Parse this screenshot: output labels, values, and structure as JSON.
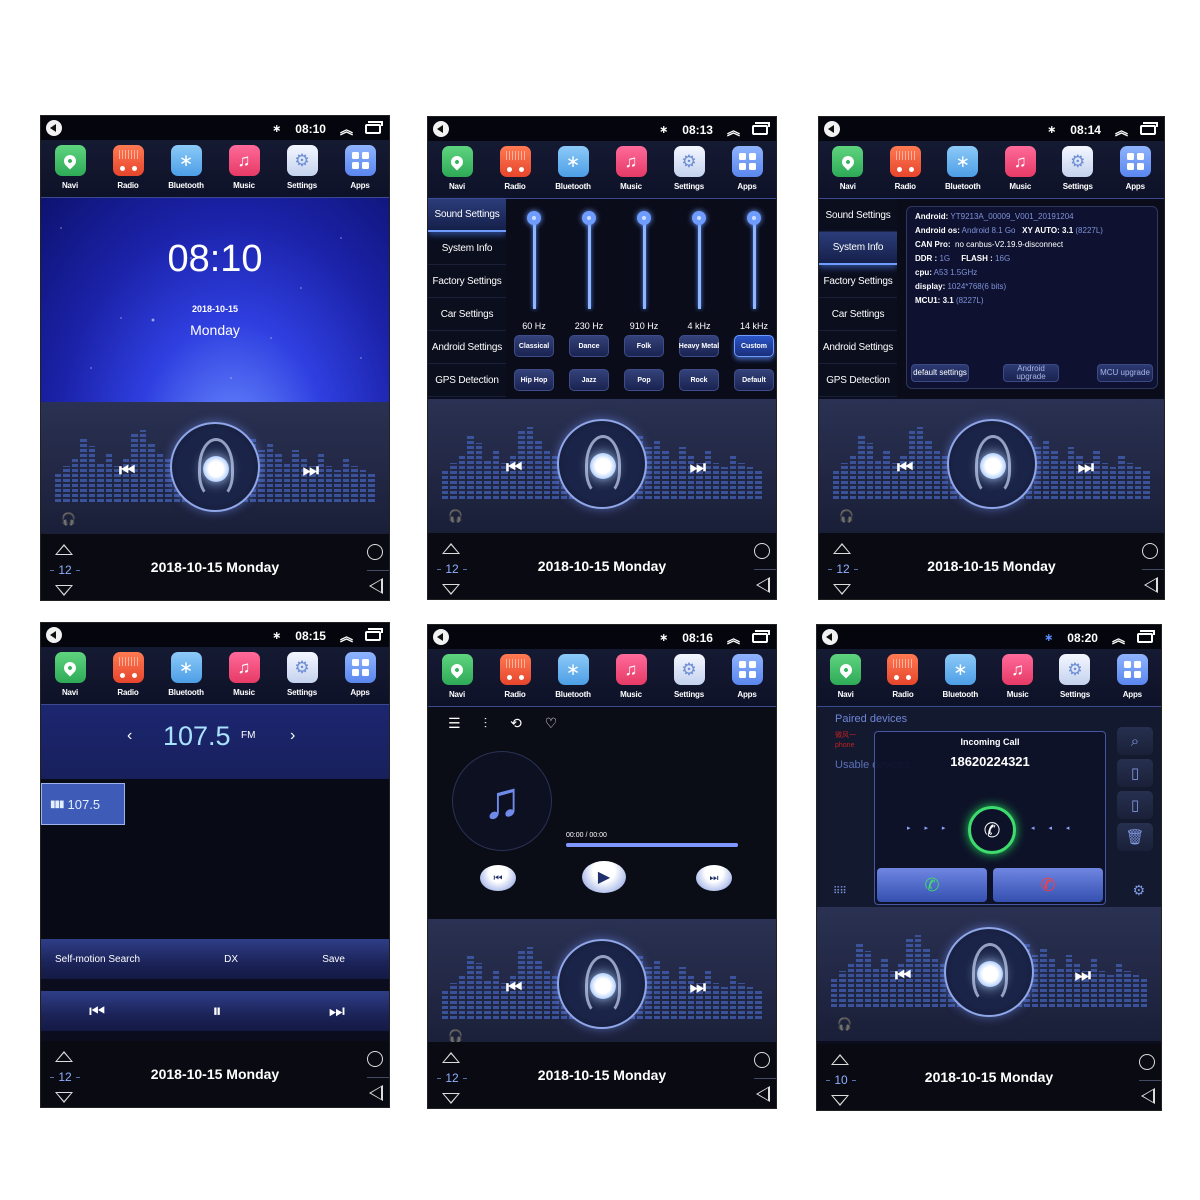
{
  "dock_apps": [
    {
      "id": "navi",
      "label": "Navi",
      "icon": "map-pin-icon",
      "color": "#3fbf68"
    },
    {
      "id": "radio",
      "label": "Radio",
      "icon": "radio-icon",
      "color": "#f05a3a"
    },
    {
      "id": "bluetooth",
      "label": "Bluetooth",
      "icon": "bluetooth-icon",
      "color": "#6cb4f2"
    },
    {
      "id": "music",
      "label": "Music",
      "icon": "music-note-icon",
      "color": "#f24d7e"
    },
    {
      "id": "settings",
      "label": "Settings",
      "icon": "gear-icon",
      "color": "#dfe6f8"
    },
    {
      "id": "apps",
      "label": "Apps",
      "icon": "grid-icon",
      "color": "#729cf6"
    }
  ],
  "glyphs": {
    "bluetooth": "∗",
    "chevron_up": "︽",
    "skip_prev": "⏮",
    "skip_next": "⏭",
    "headphones": "🎧",
    "prev": "‹",
    "next": "›",
    "bars": "▮▮▮",
    "media_prev": "⏮",
    "media_pause": "⏸",
    "media_next": "⏭",
    "list": "☰",
    "equalizer": "⫶",
    "repeat": "⟲",
    "heart": "♡",
    "music_note": "♫",
    "play": "▶",
    "phone": "✆",
    "search": "⌕",
    "phone_device": "▯",
    "trash": "🗑",
    "dialpad": "⠿⠿",
    "gear": "⚙",
    "arrows_right": "▸ ▸ ▸",
    "arrows_left": "◂ ◂ ◂"
  },
  "bottom_bar": {
    "date": "2018-10-15  Monday"
  },
  "screens": [
    {
      "name": "home",
      "status_time": "08:10",
      "volume": "12",
      "clock": "08:10",
      "date": "2018-10-15",
      "day": "Monday"
    },
    {
      "name": "sound-settings",
      "status_time": "08:13",
      "volume": "12",
      "nav": [
        "Sound Settings",
        "System Info",
        "Factory Settings",
        "Car Settings",
        "Android Settings",
        "GPS Detection"
      ],
      "active_nav": "Sound Settings",
      "eq_bands": [
        {
          "label": "60 Hz",
          "level": 1.0
        },
        {
          "label": "230 Hz",
          "level": 1.0
        },
        {
          "label": "910 Hz",
          "level": 1.0
        },
        {
          "label": "4 kHz",
          "level": 1.0
        },
        {
          "label": "14 kHz",
          "level": 1.0
        }
      ],
      "presets_row1": [
        "Classical",
        "Dance",
        "Folk",
        "Heavy Metal",
        "Custom"
      ],
      "presets_row2": [
        "Hip Hop",
        "Jazz",
        "Pop",
        "Rock",
        "Default"
      ],
      "active_preset": "Custom"
    },
    {
      "name": "system-info",
      "status_time": "08:14",
      "volume": "12",
      "nav": [
        "Sound Settings",
        "System Info",
        "Factory Settings",
        "Car Settings",
        "Android Settings",
        "GPS Detection"
      ],
      "active_nav": "System Info",
      "info": {
        "android_label": "Android:",
        "android": "YT9213A_00009_V001_20191204",
        "android_os_label": "Android os:",
        "android_os": "Android 8.1 Go",
        "xy_auto_label": "XY AUTO:",
        "xy_auto": "3.1",
        "xy_auto_code": "(8227L)",
        "can_pro_label": "CAN Pro:",
        "can_pro": "no canbus-V2.19.9-disconnect",
        "ddr_label": "DDR :",
        "ddr": "1G",
        "flash_label": "FLASH :",
        "flash": "16G",
        "cpu_label": "cpu:",
        "cpu": "A53 1.5GHz",
        "display_label": "display:",
        "display": "1024*768(6 bits)",
        "mcu_label": "MCU1:",
        "mcu": "3.1",
        "mcu_code": "(8227L)"
      },
      "buttons": {
        "default_settings": "default settings",
        "android_upgrade": "Android upgrade",
        "mcu_upgrade": "MCU upgrade"
      }
    },
    {
      "name": "radio",
      "status_time": "08:15",
      "volume": "12",
      "frequency": "107.5",
      "band": "FM",
      "preset_station": "107.5",
      "controls": {
        "search": "Self-motion Search",
        "dx": "DX",
        "save": "Save"
      }
    },
    {
      "name": "music",
      "status_time": "08:16",
      "volume": "12",
      "time_display": "00:00 / 00:00",
      "progress": 1.0
    },
    {
      "name": "bluetooth-call",
      "status_time": "08:20",
      "volume": "10",
      "paired_label": "Paired devices",
      "usable_label": "Usable devices",
      "paired_device": "微风一 phone",
      "call_title": "Incoming Call",
      "call_number": "18620224321"
    }
  ]
}
